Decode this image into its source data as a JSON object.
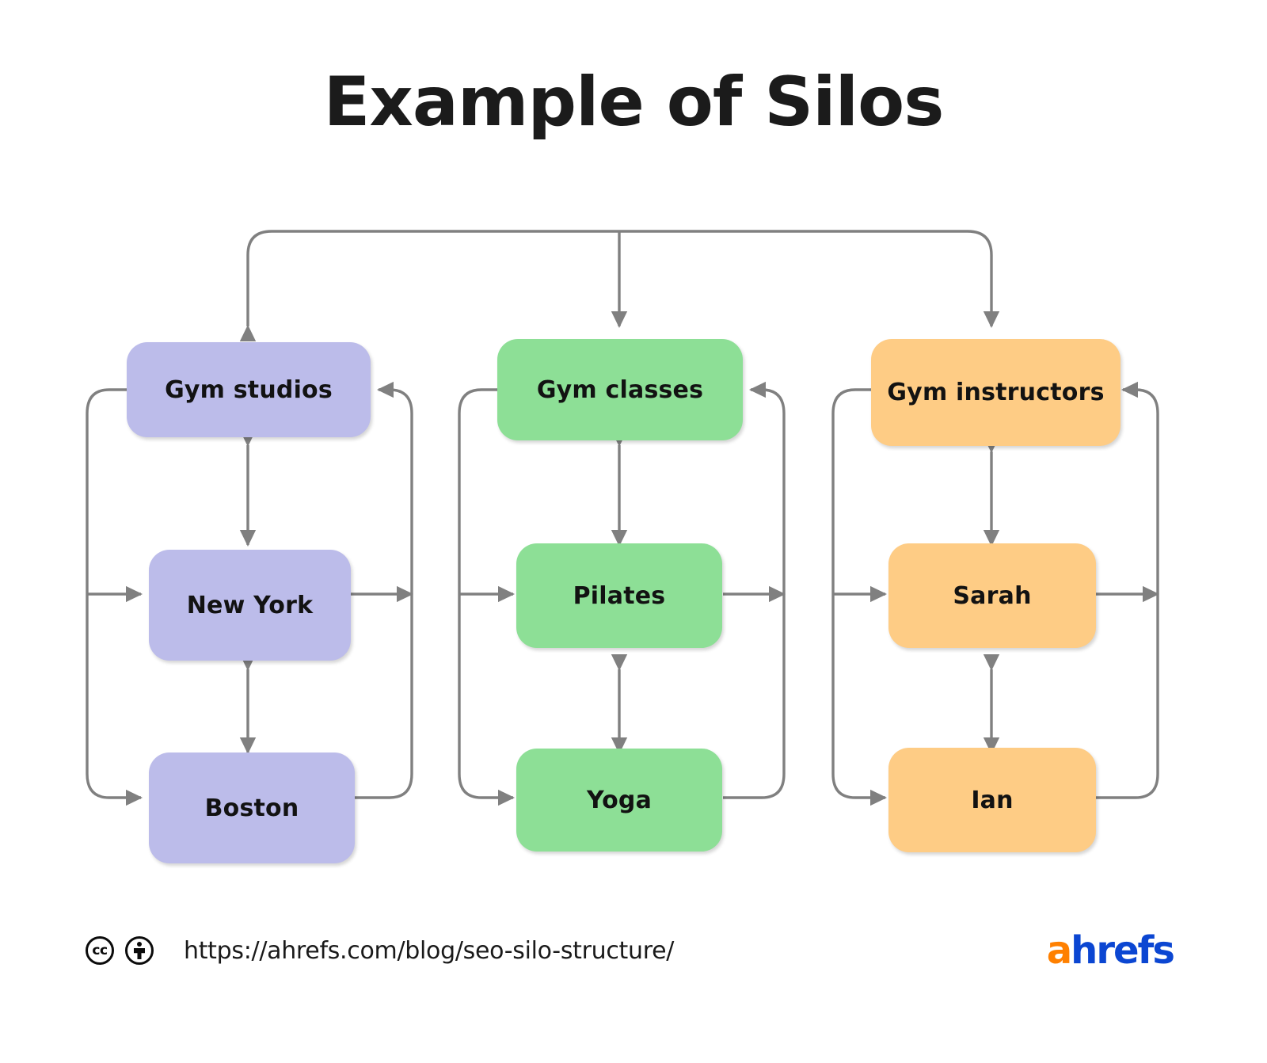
{
  "title": "Example of Silos",
  "colors": {
    "purple": "#bcbcea",
    "green": "#8ddf96",
    "orange": "#fecc85",
    "connector": "#808080",
    "text": "#121212",
    "background": "#ffffff",
    "brand_orange": "#ff8000",
    "brand_blue": "#0b46d2"
  },
  "silos": [
    {
      "id": "gym-studios",
      "color_name": "purple",
      "parent": "Gym studios",
      "children": [
        "New York",
        "Boston"
      ]
    },
    {
      "id": "gym-classes",
      "color_name": "green",
      "parent": "Gym classes",
      "children": [
        "Pilates",
        "Yoga"
      ]
    },
    {
      "id": "gym-instructors",
      "color_name": "orange",
      "parent": "Gym instructors",
      "children": [
        "Sarah",
        "Ian"
      ]
    }
  ],
  "nodes": {
    "gym_studios": "Gym studios",
    "new_york": "New York",
    "boston": "Boston",
    "gym_classes": "Gym classes",
    "pilates": "Pilates",
    "yoga": "Yoga",
    "gym_instructors": "Gym instructors",
    "sarah": "Sarah",
    "ian": "Ian"
  },
  "footer": {
    "cc_label": "cc",
    "by_label": "by",
    "url": "https://ahrefs.com/blog/seo-silo-structure/",
    "brand_first": "a",
    "brand_rest": "hrefs"
  }
}
